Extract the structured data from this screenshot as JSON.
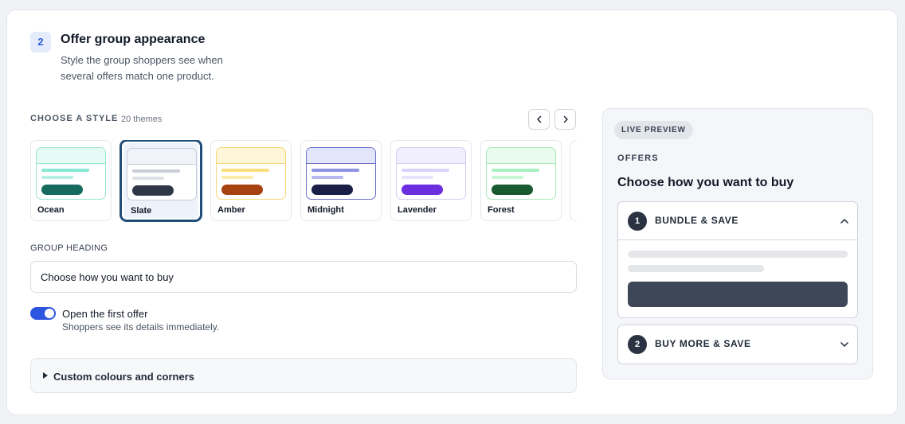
{
  "section": {
    "step": "2",
    "title": "Offer group appearance",
    "description": "Style the group shoppers see when several offers match one product."
  },
  "styles": {
    "label": "CHOOSE A STYLE",
    "count": "20 themes",
    "prev_icon": "chevron-left-icon",
    "next_icon": "chevron-right-icon",
    "selected": "Slate",
    "themes": [
      {
        "name": "Ocean",
        "border": "#99e6d0",
        "top": "#e6fbf5",
        "line1": "#86e8d4",
        "line2": "#b5f0e2",
        "pill": "#166a5e"
      },
      {
        "name": "Slate",
        "border": "#c5ccd6",
        "top": "#f0f3f7",
        "line1": "#c9cfd8",
        "line2": "#dde1e7",
        "pill": "#2e3748"
      },
      {
        "name": "Amber",
        "border": "#f5d77a",
        "top": "#fef6d6",
        "line1": "#fbde7c",
        "line2": "#fdebaa",
        "pill": "#a64210"
      },
      {
        "name": "Midnight",
        "border": "#6a70c7",
        "top": "#e3e5fa",
        "line1": "#8d92e8",
        "line2": "#b6b9ef",
        "pill": "#191f45"
      },
      {
        "name": "Lavender",
        "border": "#d5cdf3",
        "top": "#f1eefd",
        "line1": "#dcd3fb",
        "line2": "#e8e2fd",
        "pill": "#6c2fe0"
      },
      {
        "name": "Forest",
        "border": "#a8e9b8",
        "top": "#e8fbee",
        "line1": "#a7f0bf",
        "line2": "#c8f5d6",
        "pill": "#1a5a2f"
      }
    ]
  },
  "group_heading": {
    "label": "GROUP HEADING",
    "value": "Choose how you want to buy"
  },
  "open_first": {
    "label": "Open the first offer",
    "help": "Shoppers see its details immediately.",
    "enabled": true
  },
  "custom": {
    "label": "Custom colours and corners"
  },
  "preview": {
    "badge": "LIVE PREVIEW",
    "offers_label": "OFFERS",
    "heading": "Choose how you want to buy",
    "offers": [
      {
        "num": "1",
        "title": "BUNDLE & SAVE",
        "expanded": true,
        "chevron": "chevron-up-icon"
      },
      {
        "num": "2",
        "title": "BUY MORE & SAVE",
        "expanded": false,
        "chevron": "chevron-down-icon"
      }
    ]
  }
}
